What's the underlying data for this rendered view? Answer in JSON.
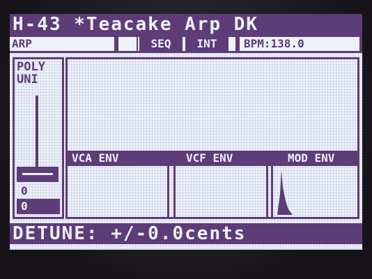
{
  "header": {
    "title": "H-43 *Teacake Arp DK"
  },
  "status": {
    "mode": "ARP",
    "seq_label": "SEQ",
    "int_label": "INT",
    "bpm": "BPM:138.0"
  },
  "voice": {
    "poly": "POLY",
    "uni": "UNI",
    "value_a": "0",
    "value_b": "0"
  },
  "envelopes": {
    "vca": "VCA ENV",
    "vcf": "VCF ENV",
    "mod": "MOD ENV"
  },
  "footer": {
    "param": "DETUNE: +/-0.0cents"
  },
  "colors": {
    "ink": "#5e3c78",
    "background": "#eef2fb"
  }
}
